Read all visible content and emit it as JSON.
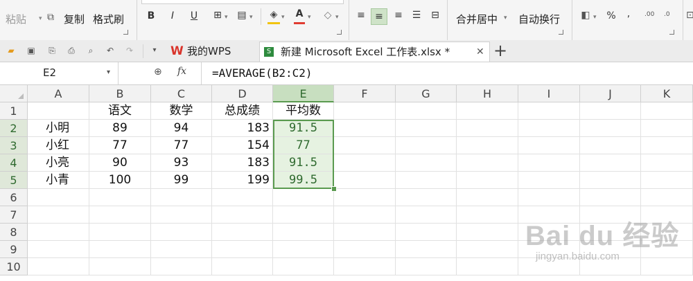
{
  "ribbon": {
    "paste": "粘贴",
    "copy": "复制",
    "format_painter": "格式刷",
    "bold": "B",
    "italic": "I",
    "underline": "U",
    "merge_center": "合并居中",
    "wrap_text": "自动换行",
    "percent": "%",
    "comma": ","
  },
  "tabs": [
    {
      "label": "我的WPS"
    },
    {
      "label": "新建 Microsoft Excel 工作表.xlsx *"
    }
  ],
  "formula_bar": {
    "name_box": "E2",
    "fx": "fx",
    "formula": "=AVERAGE(B2:C2)"
  },
  "sheet": {
    "columns": [
      "A",
      "B",
      "C",
      "D",
      "E",
      "F",
      "G",
      "H",
      "I",
      "J",
      "K"
    ],
    "rows": [
      "1",
      "2",
      "3",
      "4",
      "5",
      "6",
      "7",
      "8",
      "9",
      "10"
    ],
    "header_row": [
      "",
      "语文",
      "数学",
      "总成绩",
      "平均数"
    ],
    "data": [
      [
        "小明",
        "89",
        "94",
        "183",
        "91.5"
      ],
      [
        "小红",
        "77",
        "77",
        "154",
        "77"
      ],
      [
        "小亮",
        "90",
        "93",
        "183",
        "91.5"
      ],
      [
        "小青",
        "100",
        "99",
        "199",
        "99.5"
      ]
    ]
  },
  "watermark": {
    "brand": "Bai du 经验",
    "url": "jingyan.baidu.com"
  },
  "colors": {
    "selection_green": "#5a9a4f",
    "wps_red": "#d9342b"
  }
}
